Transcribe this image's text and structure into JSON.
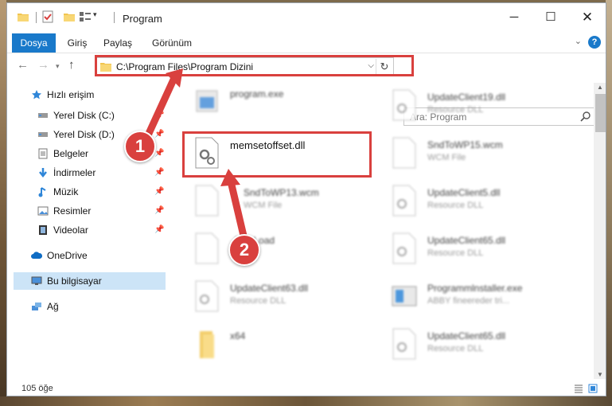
{
  "window": {
    "title": "Program",
    "controls": {
      "minimize": "─",
      "maximize": "☐",
      "close": "✕"
    }
  },
  "ribbon": {
    "tabs": [
      "Dosya",
      "Giriş",
      "Paylaş",
      "Görünüm"
    ],
    "help": "?"
  },
  "address": {
    "path": "C:\\Program Files\\Program Dizini"
  },
  "search": {
    "placeholder": "Ara: Program"
  },
  "sidebar": {
    "items": [
      {
        "label": "Hızlı erişim",
        "icon": "star-icon",
        "pinned": false
      },
      {
        "label": "Yerel Disk (C:)",
        "icon": "drive-icon",
        "pinned": true
      },
      {
        "label": "Yerel Disk (D:)",
        "icon": "drive-icon",
        "pinned": true
      },
      {
        "label": "Belgeler",
        "icon": "documents-icon",
        "pinned": true
      },
      {
        "label": "İndirmeler",
        "icon": "downloads-icon",
        "pinned": true
      },
      {
        "label": "Müzik",
        "icon": "music-icon",
        "pinned": true
      },
      {
        "label": "Resimler",
        "icon": "pictures-icon",
        "pinned": true
      },
      {
        "label": "Videolar",
        "icon": "videos-icon",
        "pinned": true
      },
      {
        "label": "OneDrive",
        "icon": "cloud-icon",
        "pinned": false
      },
      {
        "label": "Bu bilgisayar",
        "icon": "computer-icon",
        "pinned": false
      },
      {
        "label": "Ağ",
        "icon": "network-icon",
        "pinned": false
      }
    ]
  },
  "files": {
    "left": [
      {
        "name": "program.exe",
        "sub": ""
      },
      {
        "name": "memsetoffset.dll",
        "sub": ""
      },
      {
        "name": "SndToWP13.wcm",
        "sub": "WCM File"
      },
      {
        "name": "AddrLoad",
        "sub": ""
      },
      {
        "name": "UpdateClient63.dll",
        "sub": "Resource DLL"
      },
      {
        "name": "x64",
        "sub": ""
      }
    ],
    "right": [
      {
        "name": "UpdateClient19.dll",
        "sub": "Resource DLL"
      },
      {
        "name": "SndToWP15.wcm",
        "sub": "WCM File"
      },
      {
        "name": "UpdateClient5.dll",
        "sub": "Resource DLL"
      },
      {
        "name": "UpdateClient65.dll",
        "sub": "Resource DLL"
      },
      {
        "name": "Programmlnstaller.exe",
        "sub": "ABBY fineereder tri..."
      },
      {
        "name": "UpdateClient65.dll",
        "sub": "Resource DLL"
      }
    ]
  },
  "status": {
    "count": "105 öğe"
  },
  "callouts": {
    "one": "1",
    "two": "2"
  },
  "colors": {
    "accent": "#1979ca",
    "highlight": "#d9403e",
    "selected": "#cce4f7"
  }
}
